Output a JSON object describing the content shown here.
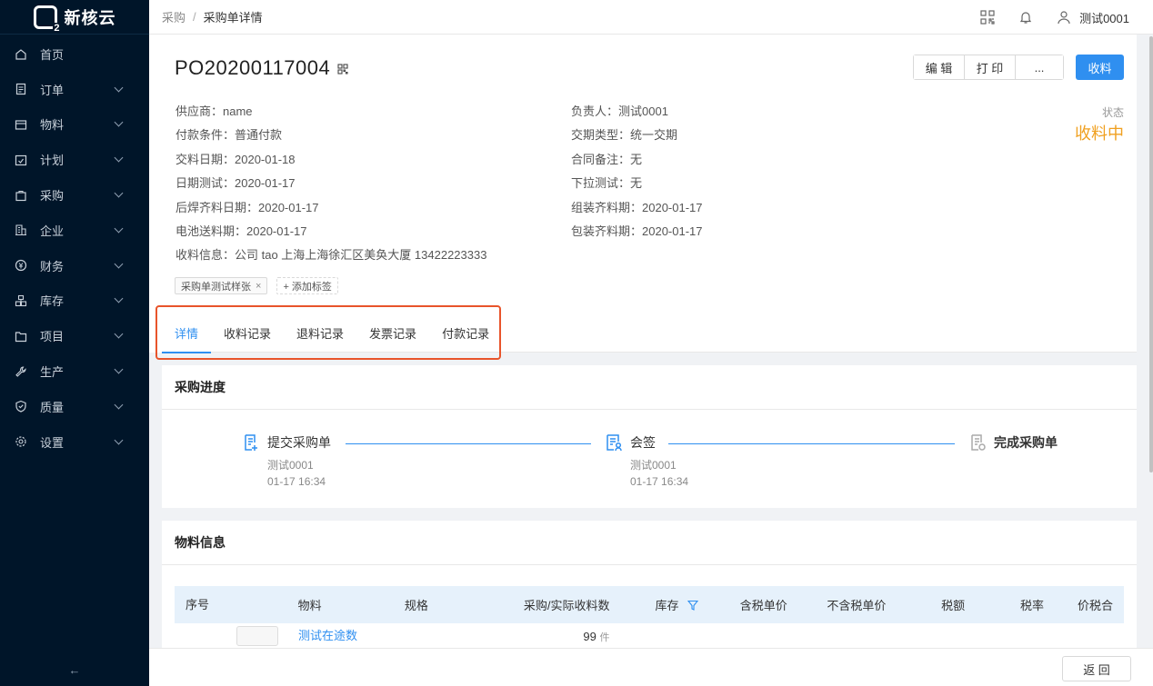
{
  "app": {
    "logo_text": "新核云"
  },
  "sidebar": {
    "items": [
      {
        "label": "首页",
        "icon": "home-icon",
        "has_children": false
      },
      {
        "label": "订单",
        "icon": "order-icon",
        "has_children": true
      },
      {
        "label": "物料",
        "icon": "material-icon",
        "has_children": true
      },
      {
        "label": "计划",
        "icon": "plan-icon",
        "has_children": true
      },
      {
        "label": "采购",
        "icon": "purchase-icon",
        "has_children": true
      },
      {
        "label": "企业",
        "icon": "enterprise-icon",
        "has_children": true
      },
      {
        "label": "财务",
        "icon": "finance-icon",
        "has_children": true
      },
      {
        "label": "库存",
        "icon": "inventory-icon",
        "has_children": true
      },
      {
        "label": "项目",
        "icon": "project-icon",
        "has_children": true
      },
      {
        "label": "生产",
        "icon": "production-icon",
        "has_children": true
      },
      {
        "label": "质量",
        "icon": "quality-icon",
        "has_children": true
      },
      {
        "label": "设置",
        "icon": "settings-icon",
        "has_children": true
      }
    ],
    "collapse_label": "←"
  },
  "topbar": {
    "breadcrumb": [
      "采购",
      "采购单详情"
    ],
    "breadcrumb_sep": "/",
    "user_name": "测试0001"
  },
  "header": {
    "po_number": "PO20200117004",
    "buttons": {
      "edit": "编 辑",
      "print": "打 印",
      "more": "...",
      "receive": "收料"
    },
    "status_label": "状态",
    "status_value": "收料中",
    "status_color": "#f0a020",
    "left_fields": [
      {
        "key": "供应商：",
        "value": "name"
      },
      {
        "key": "付款条件：",
        "value": "普通付款"
      },
      {
        "key": "交料日期：",
        "value": "2020-01-18"
      },
      {
        "key": "日期测试：",
        "value": "2020-01-17"
      },
      {
        "key": "后焊齐料日期：",
        "value": "2020-01-17"
      },
      {
        "key": "电池送料期：",
        "value": "2020-01-17"
      },
      {
        "key": "收料信息：",
        "value": "公司 tao 上海上海徐汇区美奂大厦 13422223333"
      }
    ],
    "right_fields": [
      {
        "key": "负责人：",
        "value": "测试0001"
      },
      {
        "key": "交期类型：",
        "value": "统一交期"
      },
      {
        "key": "合同备注：",
        "value": "无"
      },
      {
        "key": "下拉测试：",
        "value": "无"
      },
      {
        "key": "组装齐料期：",
        "value": "2020-01-17"
      },
      {
        "key": "包装齐料期：",
        "value": "2020-01-17"
      }
    ],
    "tag": "采购单测试样张",
    "tag_close": "×",
    "add_tag": "+ 添加标签"
  },
  "tabs": [
    "详情",
    "收料记录",
    "退料记录",
    "发票记录",
    "付款记录"
  ],
  "progress": {
    "title": "采购进度",
    "steps": [
      {
        "label": "提交采购单",
        "user": "测试0001",
        "time": "01-17 16:34"
      },
      {
        "label": "会签",
        "user": "测试0001",
        "time": "01-17 16:34"
      },
      {
        "label": "完成采购单"
      }
    ],
    "accent": "#2f8ff0"
  },
  "materials": {
    "title": "物料信息",
    "columns": [
      "序号",
      "物料",
      "规格",
      "采购/实际收料数",
      "库存",
      "含税单价",
      "不含税单价",
      "税额",
      "税率",
      "价税合"
    ],
    "rows": [
      {
        "index": "",
        "name": "测试在途数",
        "spec": "",
        "qty": "99",
        "unit": "件"
      }
    ]
  },
  "footer": {
    "back": "返 回"
  }
}
